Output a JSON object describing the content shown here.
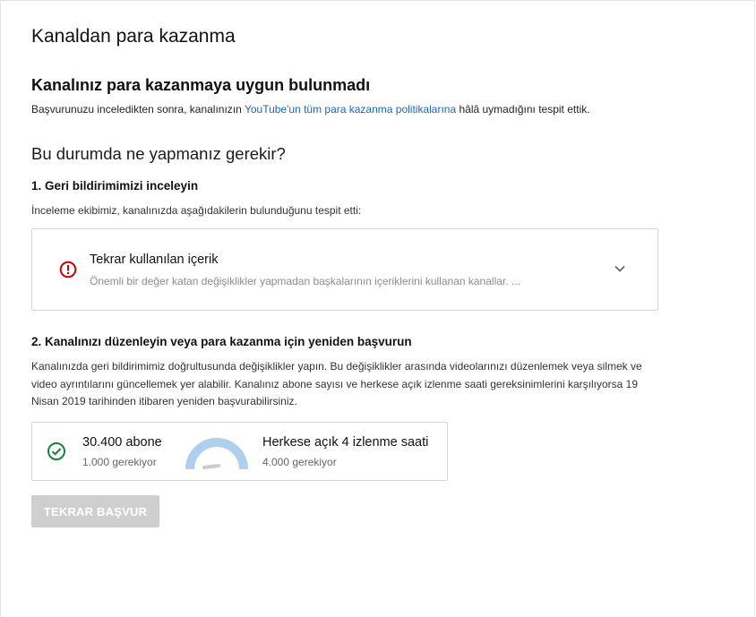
{
  "page": {
    "title": "Kanaldan para kazanma"
  },
  "status": {
    "heading": "Kanalınız para kazanmaya uygun bulunmadı",
    "intro_before": "Başvurunuzu inceledikten sonra, kanalınızın ",
    "intro_link": "YouTube'un tüm para kazanma politikalarına",
    "intro_after": " hâlâ uymadığını tespit ettik.",
    "link_color": "#1a66c4"
  },
  "next_steps": {
    "heading": "Bu durumda ne yapmanız gerekir?",
    "step1": {
      "title": "1. Geri bildirimimizi inceleyin",
      "text": "İnceleme ekibimiz, kanalınızda aşağıdakilerin bulunduğunu tespit etti:",
      "issue": {
        "icon": "error-circle-icon",
        "icon_color": "#cc0000",
        "title": "Tekrar kullanılan içerik",
        "description": "Önemli bir değer katan değişiklikler yapmadan başkalarının içeriklerini kullanan kanallar. ..."
      }
    },
    "step2": {
      "title": "2. Kanalınızı düzenleyin veya para kazanma için yeniden başvurun",
      "text": "Kanalınızda geri bildirimimiz doğrultusunda değişiklikler yapın. Bu değişiklikler arasında videolarınızı düzenlemek veya silmek ve video ayrıntılarını güncellemek yer alabilir. Kanalınız abone sayısı ve herkese açık izlenme saati gereksinimlerini karşılıyorsa 19 Nisan 2019 tarihinden itibaren yeniden başvurabilirsiniz.",
      "requirements": {
        "subscribers_value": "30.400 abone",
        "subscribers_required": "1.000 gerekiyor",
        "subscribers_met": true,
        "check_color": "#188038",
        "hours_value": "Herkese açık 4 izlenme saati",
        "hours_required": "4.000 gerekiyor",
        "hours_progress": 0.001,
        "gauge_color": "#aecfee",
        "needle_color": "#cccccc"
      }
    }
  },
  "actions": {
    "reapply_label": "TEKRAR BAŞVUR",
    "reapply_disabled": true
  }
}
